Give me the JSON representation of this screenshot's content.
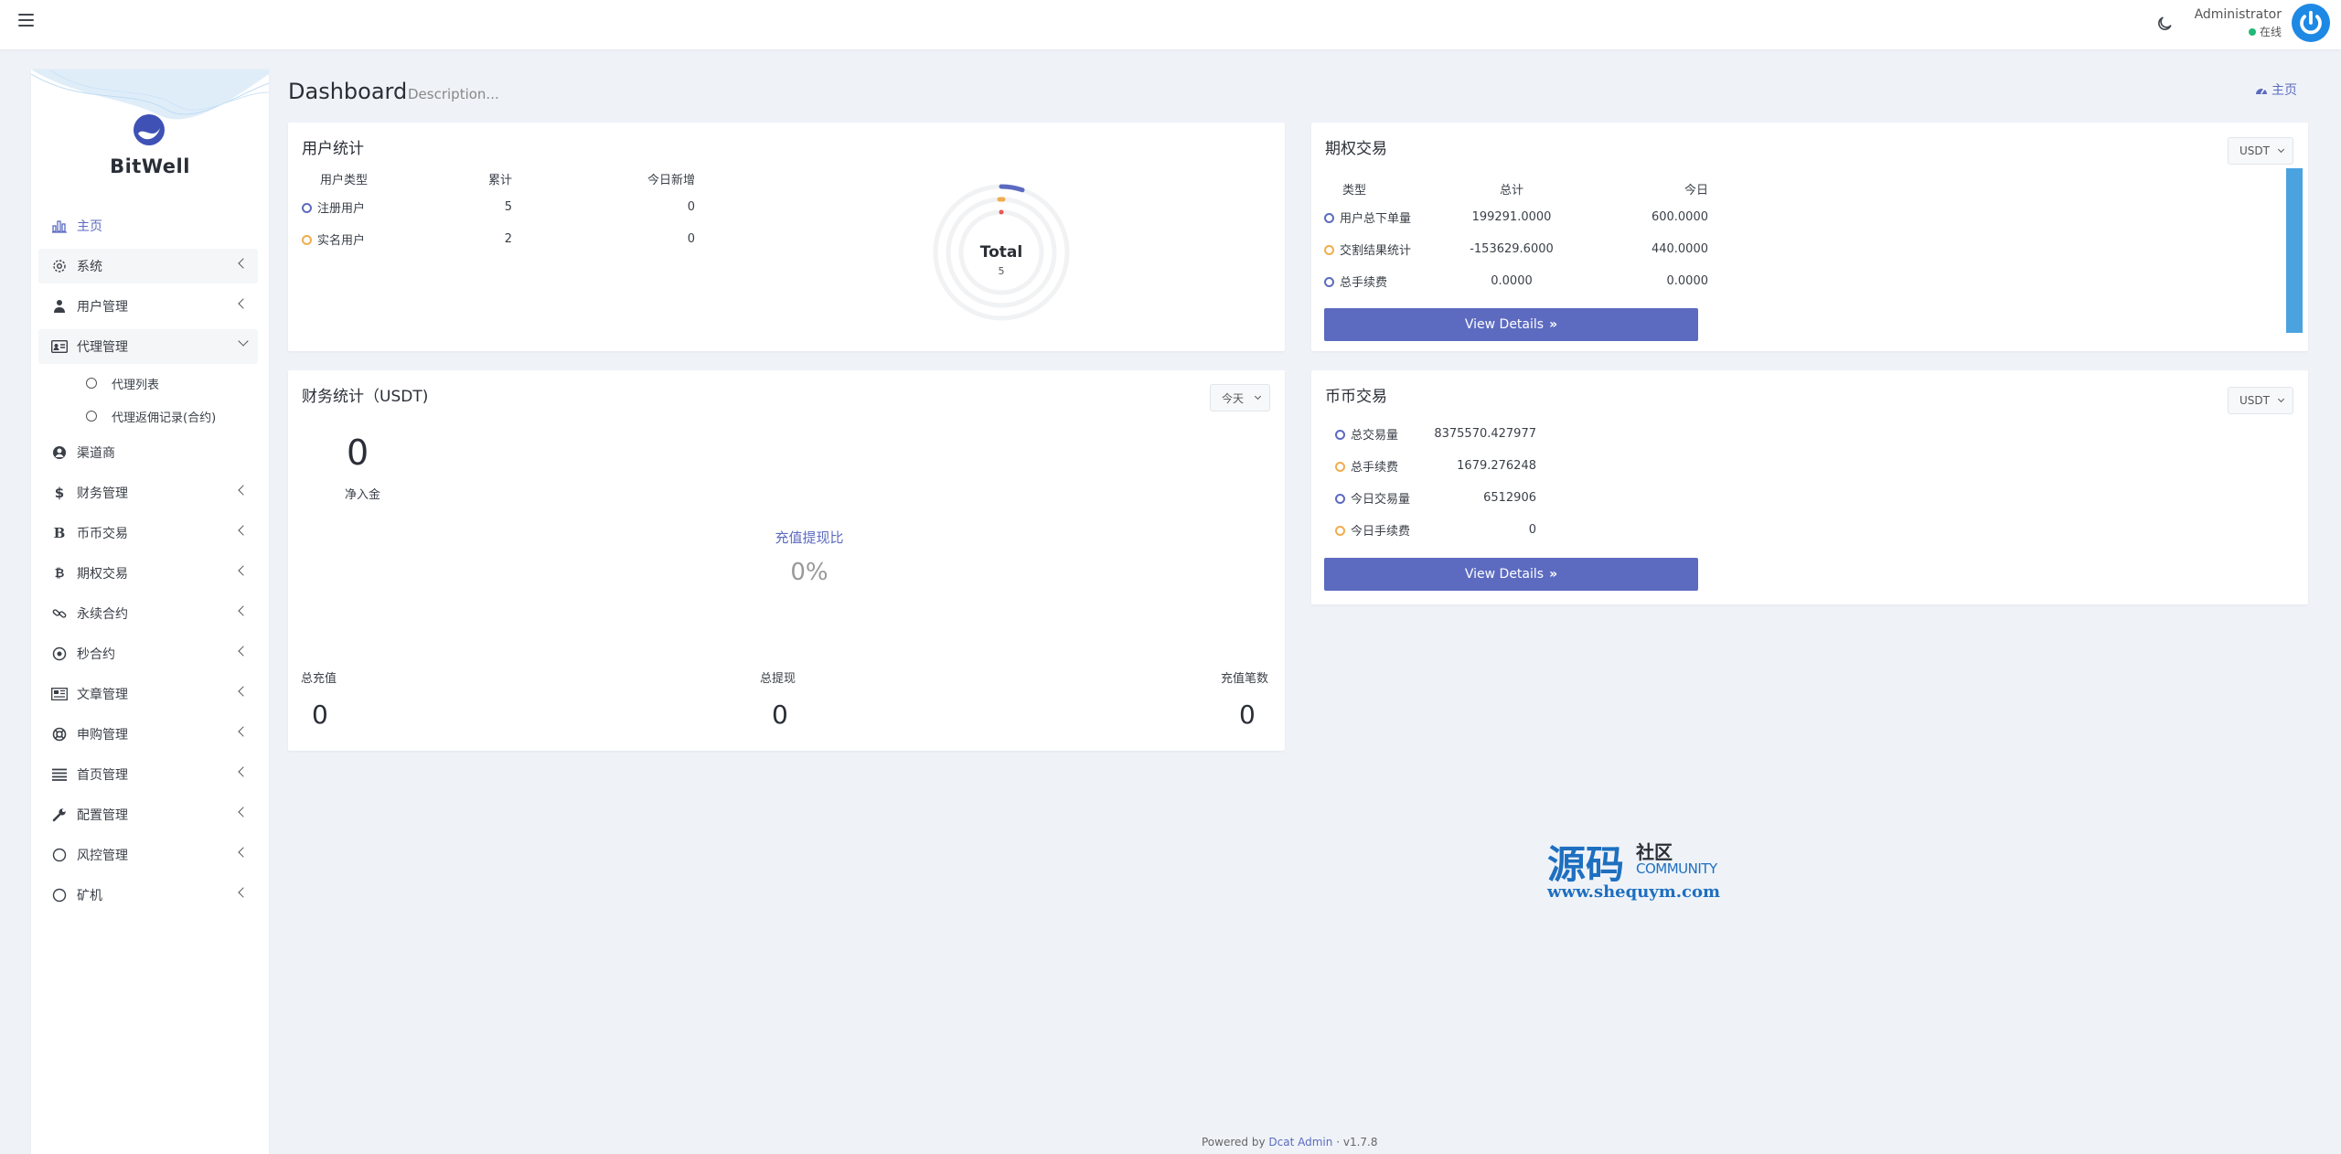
{
  "header": {
    "user_name": "Administrator",
    "user_status": "在线"
  },
  "brand": {
    "name": "BitWell"
  },
  "sidebar": {
    "items": [
      {
        "label": "主页",
        "icon": "bar-chart-icon"
      },
      {
        "label": "系统",
        "icon": "gear-icon"
      },
      {
        "label": "用户管理",
        "icon": "user-tie-icon"
      },
      {
        "label": "代理管理",
        "icon": "id-card-icon"
      },
      {
        "label": "渠道商",
        "icon": "user-circle-icon"
      },
      {
        "label": "财务管理",
        "icon": "dollar-icon"
      },
      {
        "label": "币币交易",
        "icon": "bitcoin-b-icon"
      },
      {
        "label": "期权交易",
        "icon": "bitcoin-icon"
      },
      {
        "label": "永续合约",
        "icon": "link-icon"
      },
      {
        "label": "秒合约",
        "icon": "dot-circle-icon"
      },
      {
        "label": "文章管理",
        "icon": "newspaper-icon"
      },
      {
        "label": "申购管理",
        "icon": "life-ring-icon"
      },
      {
        "label": "首页管理",
        "icon": "list-icon"
      },
      {
        "label": "配置管理",
        "icon": "wrench-icon"
      },
      {
        "label": "风控管理",
        "icon": "circle-icon"
      },
      {
        "label": "矿机",
        "icon": "circle-icon"
      }
    ],
    "submenu": [
      {
        "label": "代理列表"
      },
      {
        "label": "代理返佣记录(合约)"
      }
    ]
  },
  "page": {
    "title": "Dashboard",
    "description": "Description...",
    "home_link": "主页"
  },
  "user_stats": {
    "title": "用户统计",
    "headers": [
      "用户类型",
      "累计",
      "今日新增"
    ],
    "rows": [
      {
        "label": "注册用户",
        "total": "5",
        "today": "0"
      },
      {
        "label": "实名用户",
        "total": "2",
        "today": "0"
      }
    ],
    "donut_label": "Total",
    "donut_value": "5"
  },
  "options_trade": {
    "title": "期权交易",
    "select": "USDT",
    "headers": [
      "类型",
      "总计",
      "今日"
    ],
    "rows": [
      {
        "label": "用户总下单量",
        "total": "199291.0000",
        "today": "600.0000"
      },
      {
        "label": "交割结果统计",
        "total": "-153629.6000",
        "today": "440.0000"
      },
      {
        "label": "总手续费",
        "total": "0.0000",
        "today": "0.0000"
      }
    ],
    "button": "View Details"
  },
  "finance": {
    "title": "财务统计（USDT)",
    "select": "今天",
    "net_value": "0",
    "net_label": "净入金",
    "ratio_label": "充值提现比",
    "ratio_value": "0%",
    "stats": [
      {
        "label": "总充值",
        "value": "0"
      },
      {
        "label": "总提现",
        "value": "0"
      },
      {
        "label": "充值笔数",
        "value": "0"
      }
    ]
  },
  "coin_trade": {
    "title": "币币交易",
    "select": "USDT",
    "rows": [
      {
        "label": "总交易量",
        "value": "8375570.427977"
      },
      {
        "label": "总手续费",
        "value": "1679.276248"
      },
      {
        "label": "今日交易量",
        "value": "6512906"
      },
      {
        "label": "今日手续费",
        "value": "0"
      }
    ],
    "button": "View Details"
  },
  "watermark": {
    "main": "源码",
    "side": "社区",
    "community": "COMMUNITY",
    "url": "www.shequym.com"
  },
  "footer": {
    "prefix": "Powered by",
    "link": "Dcat Admin",
    "sep": "·",
    "version": "v1.7.8"
  },
  "colors": {
    "primary": "#5c6bc0",
    "orange": "#f0ad4e",
    "red": "#ea5455",
    "online": "#21b978",
    "bar": "#4aa3df"
  }
}
